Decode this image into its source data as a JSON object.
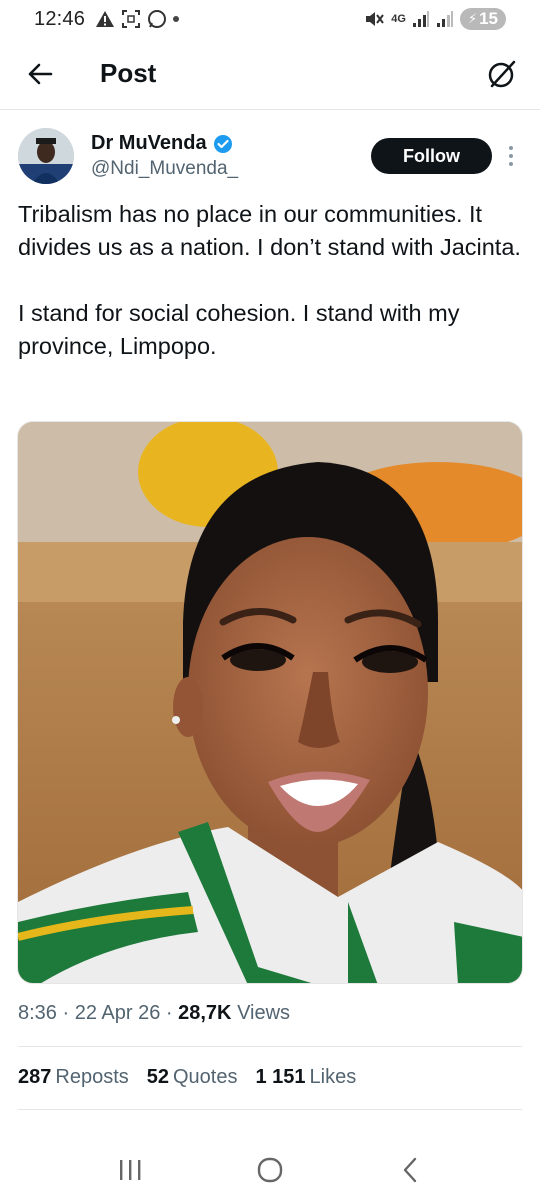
{
  "status_bar": {
    "time": "12:46",
    "network": "4G",
    "battery": "15",
    "icons": [
      "alert-icon",
      "screenshot-icon",
      "whatsapp-icon",
      "dot-icon",
      "mute-icon",
      "signal-icon",
      "signal-icon",
      "battery-icon"
    ]
  },
  "header": {
    "title": "Post",
    "back_icon": "back-arrow-icon",
    "grok_icon": "grok-icon"
  },
  "author": {
    "display_name": "Dr MuVenda",
    "handle": "@Ndi_Muvenda_",
    "verified": true,
    "follow_label": "Follow"
  },
  "tweet": {
    "text": "Tribalism has no place in our communities. It divides us as a nation. I don’t stand with Jacinta.\n\nI stand for social cohesion. I stand with my province, Limpopo."
  },
  "meta": {
    "time": "8:36",
    "date": "22 Apr 26",
    "views_count": "28,7K",
    "views_label": "Views"
  },
  "stats": {
    "reposts_count": "287",
    "reposts_label": "Reposts",
    "quotes_count": "52",
    "quotes_label": "Quotes",
    "likes_count": "1 151",
    "likes_label": "Likes"
  },
  "colors": {
    "text_primary": "#0f1419",
    "text_secondary": "#536471",
    "verified_blue": "#1d9bf0",
    "divider": "#e6e6e6",
    "jersey_green": "#1e7a3a"
  }
}
